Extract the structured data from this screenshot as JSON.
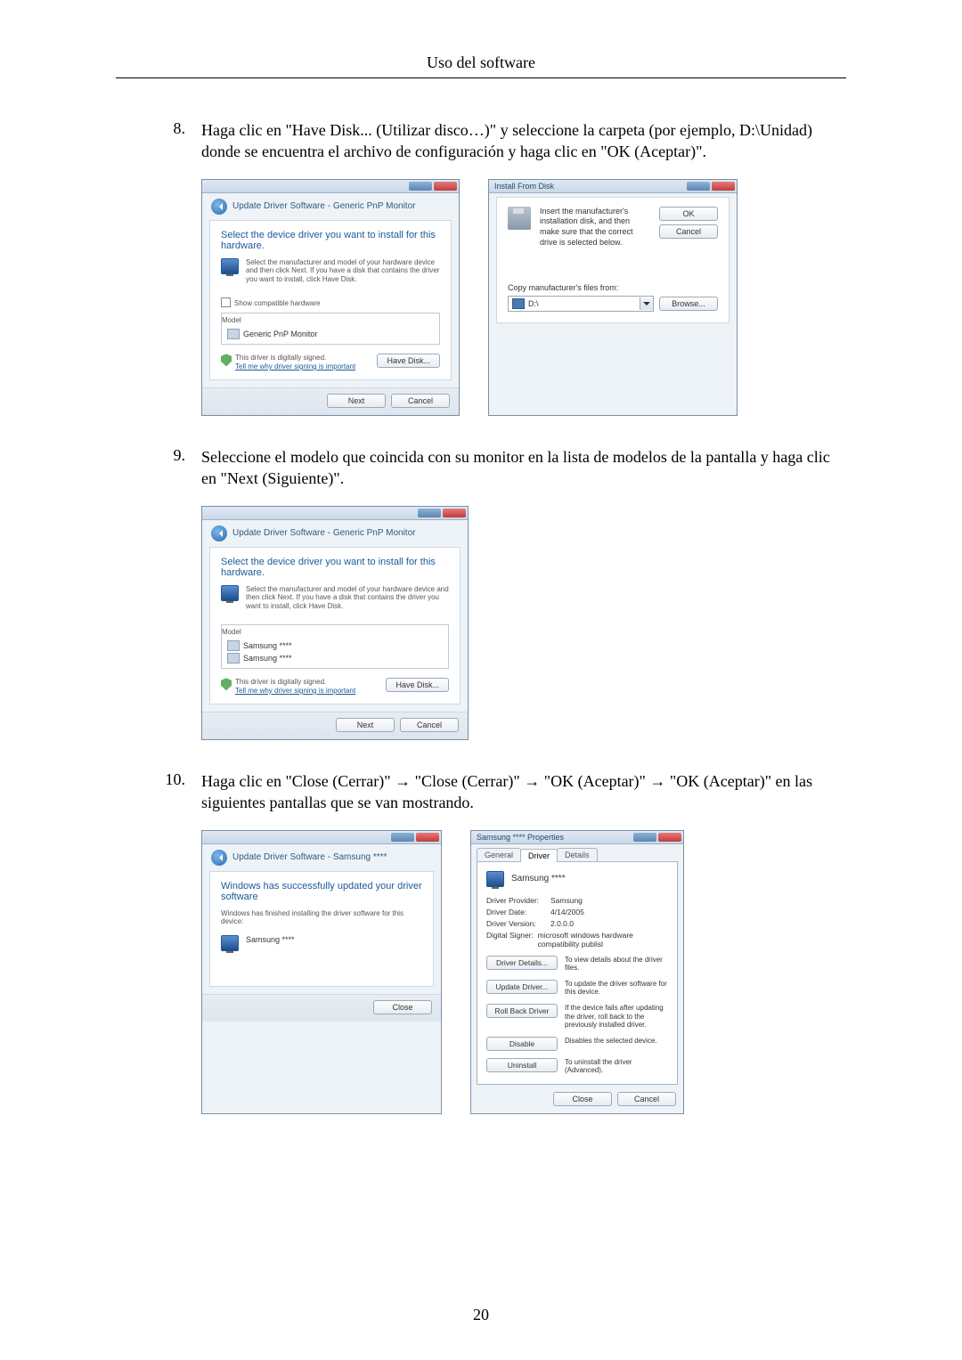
{
  "page": {
    "header": "Uso del software",
    "number": "20"
  },
  "steps": {
    "s8": {
      "num": "8.",
      "text": "Haga clic en \"Have Disk... (Utilizar disco…)\" y seleccione la carpeta (por ejemplo, D:\\Unidad) donde se encuentra el archivo de configuración y haga clic en \"OK (Aceptar)\"."
    },
    "s9": {
      "num": "9.",
      "text": "Seleccione el modelo que coincida con su monitor en la lista de modelos de la pantalla y haga clic en \"Next (Siguiente)\"."
    },
    "s10": {
      "num": "10.",
      "text": "Haga clic en \"Close (Cerrar)\" → \"Close (Cerrar)\" → \"OK (Aceptar)\" → \"OK (Aceptar)\" en las siguientes pantallas que se van mostrando."
    }
  },
  "dlg8a": {
    "crumb": "Update Driver Software - Generic PnP Monitor",
    "heading": "Select the device driver you want to install for this hardware.",
    "sub": "Select the manufacturer and model of your hardware device and then click Next. If you have a disk that contains the driver you want to install, click Have Disk.",
    "check": "Show compatible hardware",
    "list_label": "Model",
    "item": "Generic PnP Monitor",
    "signed": "This driver is digitally signed.",
    "tell": "Tell me why driver signing is important",
    "have_disk": "Have Disk...",
    "next": "Next",
    "cancel": "Cancel"
  },
  "dlg8b": {
    "title": "Install From Disk",
    "msg": "Insert the manufacturer's installation disk, and then make sure that the correct drive is selected below.",
    "ok": "OK",
    "cancel": "Cancel",
    "copy": "Copy manufacturer's files from:",
    "drive": "D:\\",
    "browse": "Browse..."
  },
  "dlg9": {
    "crumb": "Update Driver Software - Generic PnP Monitor",
    "heading": "Select the device driver you want to install for this hardware.",
    "sub": "Select the manufacturer and model of your hardware device and then click Next. If you have a disk that contains the driver you want to install, click Have Disk.",
    "list_label": "Model",
    "item1": "Samsung ****",
    "item2": "Samsung ****",
    "signed": "This driver is digitally signed.",
    "tell": "Tell me why driver signing is important",
    "have_disk": "Have Disk...",
    "next": "Next",
    "cancel": "Cancel"
  },
  "dlg10a": {
    "crumb": "Update Driver Software - Samsung ****",
    "heading": "Windows has successfully updated your driver software",
    "sub": "Windows has finished installing the driver software for this device:",
    "item": "Samsung ****",
    "close": "Close"
  },
  "dlg10b": {
    "title": "Samsung **** Properties",
    "tab_general": "General",
    "tab_driver": "Driver",
    "tab_details": "Details",
    "device": "Samsung ****",
    "provider_k": "Driver Provider:",
    "provider_v": "Samsung",
    "date_k": "Driver Date:",
    "date_v": "4/14/2005",
    "version_k": "Driver Version:",
    "version_v": "2.0.0.0",
    "signer_k": "Digital Signer:",
    "signer_v": "microsoft windows hardware compatibility publisl",
    "btn_details": "Driver Details...",
    "desc_details": "To view details about the driver files.",
    "btn_update": "Update Driver...",
    "desc_update": "To update the driver software for this device.",
    "btn_rollback": "Roll Back Driver",
    "desc_rollback": "If the device fails after updating the driver, roll back to the previously installed driver.",
    "btn_disable": "Disable",
    "desc_disable": "Disables the selected device.",
    "btn_uninstall": "Uninstall",
    "desc_uninstall": "To uninstall the driver (Advanced).",
    "close": "Close",
    "cancel": "Cancel"
  }
}
